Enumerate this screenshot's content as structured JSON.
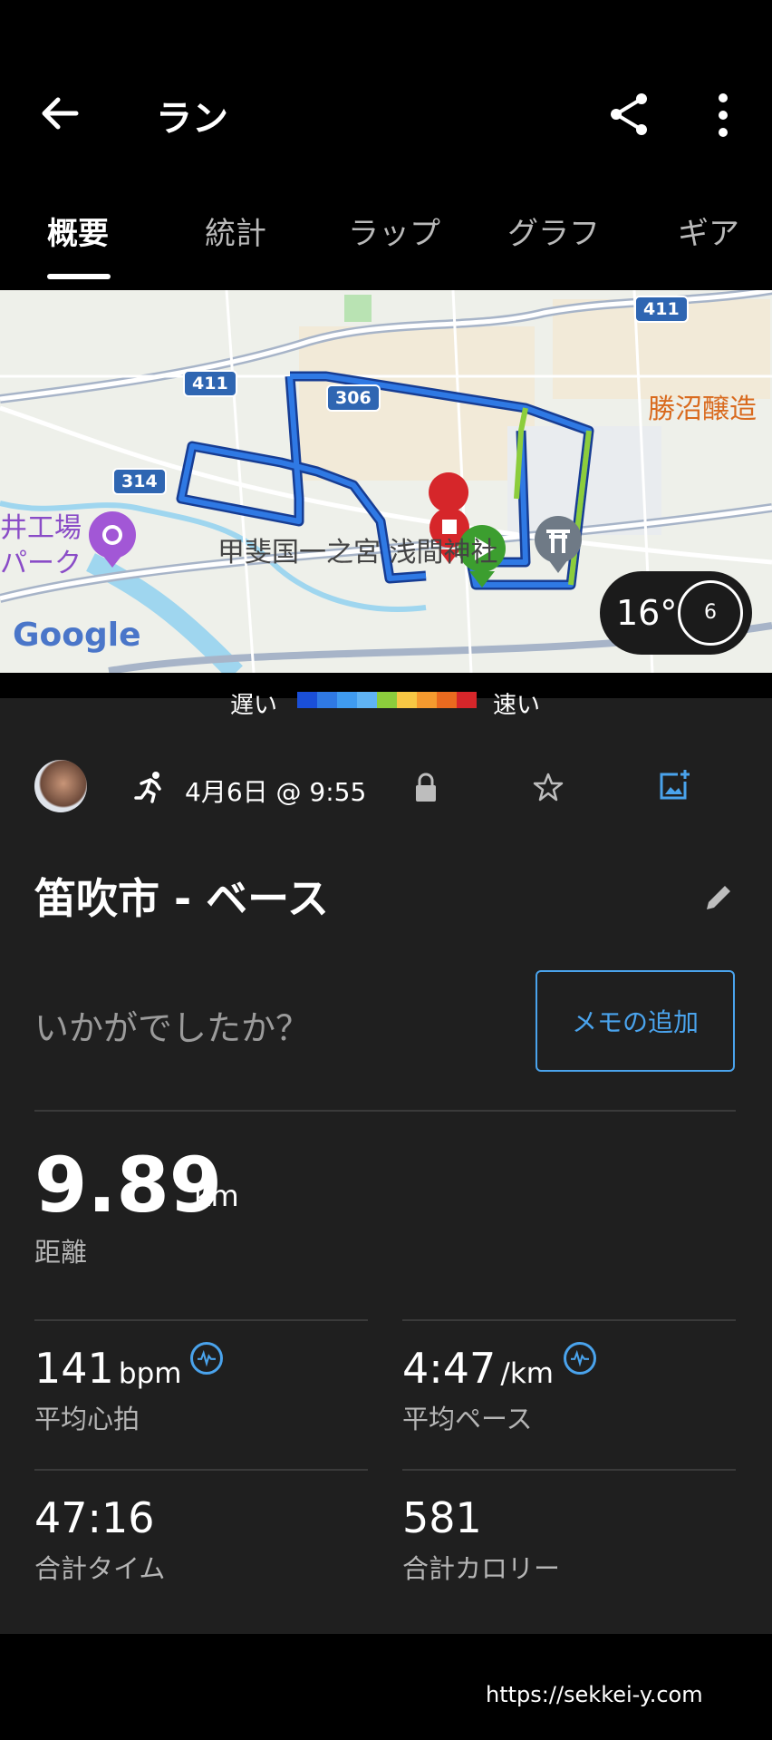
{
  "header": {
    "title": "ラン",
    "back_icon": "arrow-left-icon",
    "share_icon": "share-icon",
    "menu_icon": "more-vert-icon"
  },
  "tabs": [
    {
      "label": "概要",
      "active": true
    },
    {
      "label": "統計"
    },
    {
      "label": "ラップ"
    },
    {
      "label": "グラフ"
    },
    {
      "label": "ギア"
    }
  ],
  "map": {
    "labels": {
      "place1": "勝沼醸造",
      "place2": "甲斐国一之宮 浅間神社",
      "place3": "井工場",
      "place4": "パーク",
      "route411a": "411",
      "route411b": "411",
      "route306": "306",
      "route314": "314",
      "google": "Google"
    },
    "weather": {
      "temp": "16°",
      "wind": "6"
    }
  },
  "legend": {
    "slow": "遅い",
    "fast": "速い",
    "colors": [
      "#1a4fd8",
      "#2f79e4",
      "#3f9bf0",
      "#5fb3f4",
      "#8ccd3c",
      "#f7c744",
      "#f59a2e",
      "#ea6a1f",
      "#d6262a"
    ]
  },
  "activity": {
    "sport_icon": "running-icon",
    "datetime": "4月6日 @ 9:55",
    "lock_icon": "lock-icon",
    "star_icon": "star-outline-icon",
    "photo_icon": "add-photo-icon"
  },
  "title": "笛吹市 - ベース",
  "feeling_prompt": "いかがでしたか？",
  "memo_button": "メモの追加",
  "distance": {
    "value": "9.89",
    "unit": "km",
    "label": "距離"
  },
  "stats": [
    {
      "value": "141",
      "unit": "bpm",
      "label": "平均心拍",
      "badge": true
    },
    {
      "value": "4:47",
      "unit": "/km",
      "label": "平均ペース",
      "badge": true
    },
    {
      "value": "47:16",
      "unit": "",
      "label": "合計タイム"
    },
    {
      "value": "581",
      "unit": "",
      "label": "合計カロリー"
    }
  ],
  "footer": {
    "url": "https://sekkei-y.com"
  }
}
